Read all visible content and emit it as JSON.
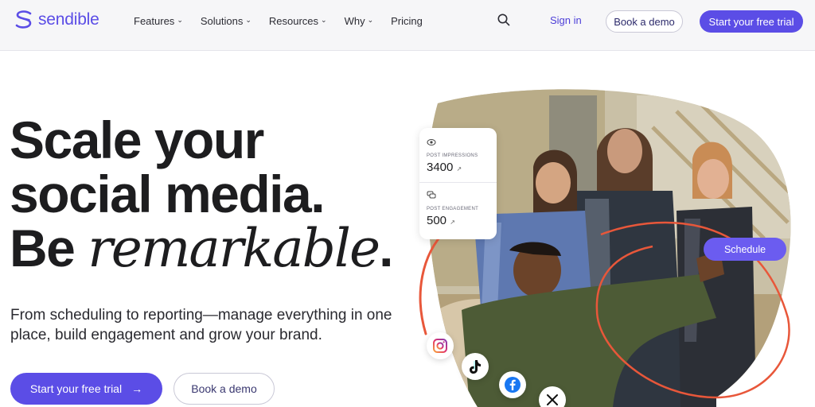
{
  "nav": {
    "logo_text": "sendible",
    "items": [
      {
        "label": "Features",
        "has_dropdown": true
      },
      {
        "label": "Solutions",
        "has_dropdown": true
      },
      {
        "label": "Resources",
        "has_dropdown": true
      },
      {
        "label": "Why",
        "has_dropdown": true
      },
      {
        "label": "Pricing",
        "has_dropdown": false
      }
    ],
    "search_icon": "search-icon",
    "sign_in": "Sign in",
    "book_demo": "Book a demo",
    "start_trial": "Start your free trial"
  },
  "hero": {
    "headline_line1": "Scale your",
    "headline_line2": "social media.",
    "headline_line3_prefix": "Be ",
    "headline_line3_emphasis": "remarkable",
    "headline_line3_suffix": ".",
    "subtext": "From scheduling to reporting—manage everything in one place, build engagement and grow your brand.",
    "cta_primary": "Start your free trial",
    "cta_primary_icon": "→",
    "cta_secondary": "Book a demo"
  },
  "visual": {
    "stats": [
      {
        "label": "POST IMPRESSIONS",
        "value": "3400",
        "trend_icon": "↗",
        "icon": "eye-icon"
      },
      {
        "label": "POST ENGAGEMENT",
        "value": "500",
        "trend_icon": "↗",
        "icon": "chat-icon"
      }
    ],
    "schedule_label": "Schedule",
    "social_icons": [
      "instagram-icon",
      "tiktok-icon",
      "facebook-icon",
      "x-icon"
    ]
  },
  "colors": {
    "brand": "#5b4de6",
    "accent_orange": "#e8573a",
    "schedule_pill": "#6b5cf0"
  }
}
